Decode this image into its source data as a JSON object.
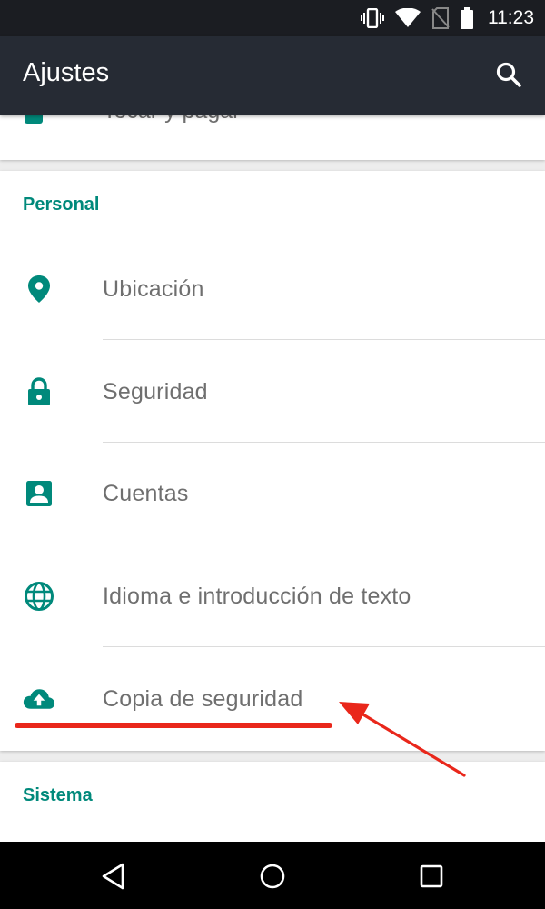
{
  "status_bar": {
    "time": "11:23",
    "icons": [
      "vibrate-icon",
      "wifi-icon",
      "no-sim-icon",
      "battery-icon"
    ]
  },
  "app_bar": {
    "title": "Ajustes",
    "search_icon": "search-icon"
  },
  "partial_item": {
    "label": "Tocar y pagar"
  },
  "personal": {
    "header": "Personal",
    "items": [
      {
        "label": "Ubicación",
        "icon": "location-pin-icon"
      },
      {
        "label": "Seguridad",
        "icon": "lock-icon"
      },
      {
        "label": "Cuentas",
        "icon": "account-box-icon"
      },
      {
        "label": "Idioma e introducción de texto",
        "icon": "globe-icon"
      },
      {
        "label": "Copia de seguridad",
        "icon": "cloud-upload-icon"
      }
    ]
  },
  "sistema": {
    "header": "Sistema"
  },
  "colors": {
    "accent": "#00897b",
    "app_bar": "#262b34",
    "status_bar": "#1b1d22",
    "annotation": "#e9271b"
  },
  "nav_bar": {
    "buttons": [
      "back-icon",
      "home-icon",
      "recents-icon"
    ]
  }
}
